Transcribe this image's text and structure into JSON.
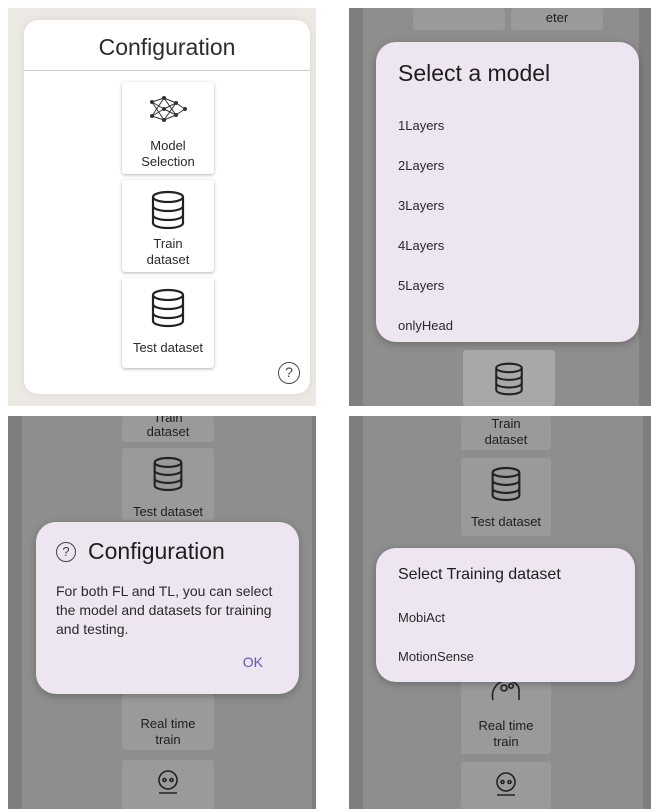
{
  "panel1": {
    "title": "Configuration",
    "tiles": [
      {
        "label_line1": "Model",
        "label_line2": "Selection",
        "icon": "neural-network-icon"
      },
      {
        "label_line1": "Train",
        "label_line2": "dataset",
        "icon": "database-icon"
      },
      {
        "label": "Test dataset",
        "icon": "database-icon"
      }
    ],
    "help_symbol": "?"
  },
  "panel2": {
    "bg_fragment": "eter",
    "dialog": {
      "title": "Select a model",
      "options": [
        "1Layers",
        "2Layers",
        "3Layers",
        "4Layers",
        "5Layers",
        "onlyHead"
      ]
    }
  },
  "panel3": {
    "bg_train": {
      "line1": "Train",
      "line2": "dataset"
    },
    "bg_test": "Test dataset",
    "bg_realtime": {
      "line1": "Real time",
      "line2": "train"
    },
    "dialog": {
      "help_symbol": "?",
      "title": "Configuration",
      "body": "For both FL and TL, you can select the model and datasets for training and testing.",
      "ok": "OK"
    }
  },
  "panel4": {
    "bg_train": {
      "line1": "Train",
      "line2": "dataset"
    },
    "bg_test": "Test dataset",
    "bg_realtime": {
      "line1": "Real time",
      "line2": "train"
    },
    "dialog": {
      "title": "Select Training dataset",
      "options": [
        "MobiAct",
        "MotionSense"
      ]
    }
  },
  "colors": {
    "dialog_bg": "#ede5f0",
    "accent": "#6a55b0",
    "scrim": "#7f7f7f"
  }
}
